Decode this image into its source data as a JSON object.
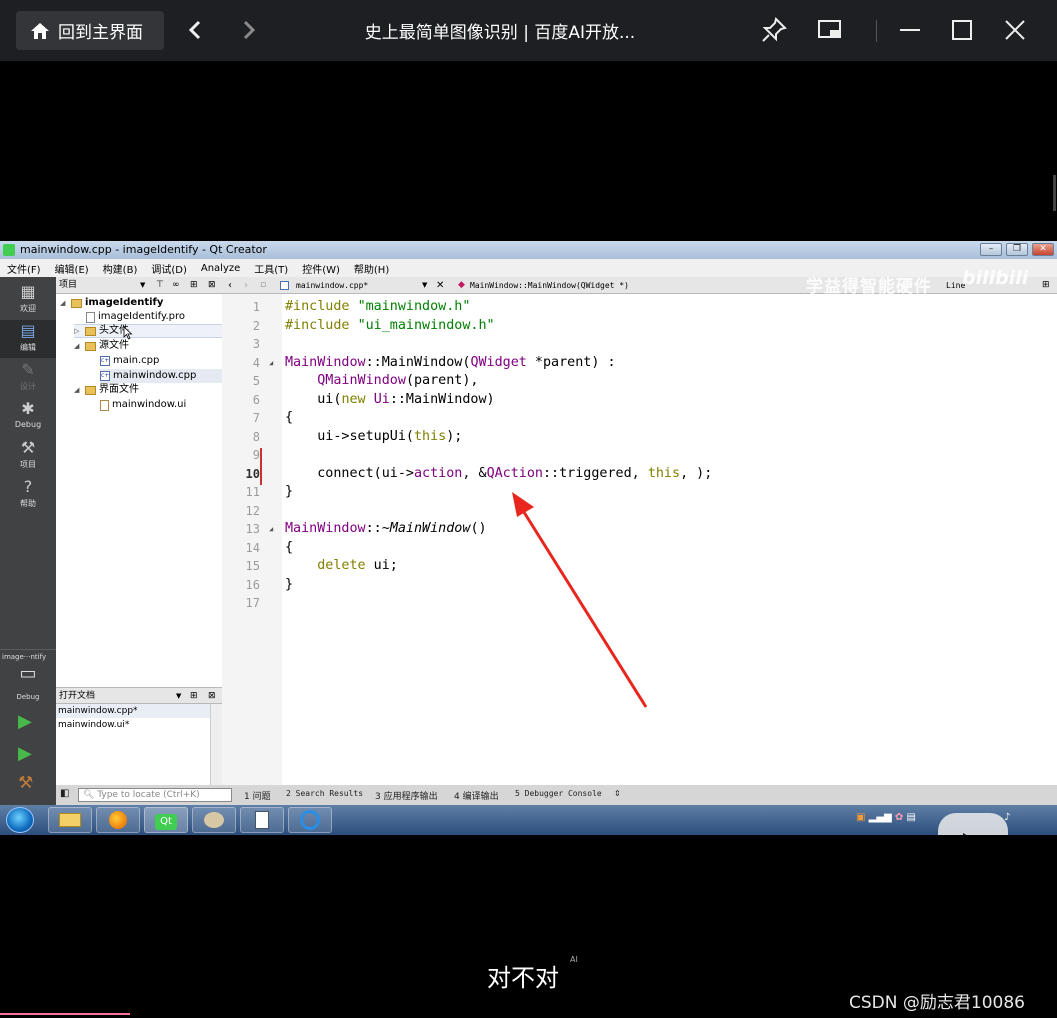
{
  "player": {
    "home_label": "回到主界面",
    "title": "史上最简单图像识别 | 百度AI开放...",
    "icons": [
      "home-icon",
      "back-icon",
      "forward-icon",
      "pin-icon",
      "pip-icon",
      "minimize-icon",
      "maximize-icon",
      "close-icon"
    ]
  },
  "qt": {
    "window_title": "mainwindow.cpp - imageIdentify - Qt Creator",
    "menu": [
      "文件(F)",
      "编辑(E)",
      "构建(B)",
      "调试(D)",
      "Analyze",
      "工具(T)",
      "控件(W)",
      "帮助(H)"
    ],
    "modes": [
      {
        "label": "欢迎",
        "icon": "grid-icon"
      },
      {
        "label": "编辑",
        "icon": "edit-icon"
      },
      {
        "label": "设计",
        "icon": "pen-icon"
      },
      {
        "label": "Debug",
        "icon": "bug-icon"
      },
      {
        "label": "项目",
        "icon": "wrench-icon"
      },
      {
        "label": "帮助",
        "icon": "help-icon"
      }
    ],
    "target": {
      "project": "image···ntify",
      "config": "Debug"
    },
    "project_panel_title": "项目",
    "tree": [
      {
        "label": "imageIdentify",
        "depth": 0,
        "type": "project"
      },
      {
        "label": "imageIdentify.pro",
        "depth": 1,
        "type": "file"
      },
      {
        "label": "头文件",
        "depth": 1,
        "type": "folder"
      },
      {
        "label": "源文件",
        "depth": 1,
        "type": "folder"
      },
      {
        "label": "main.cpp",
        "depth": 2,
        "type": "cpp"
      },
      {
        "label": "mainwindow.cpp",
        "depth": 2,
        "type": "cpp"
      },
      {
        "label": "界面文件",
        "depth": 1,
        "type": "folder"
      },
      {
        "label": "mainwindow.ui",
        "depth": 2,
        "type": "ui"
      }
    ],
    "open_docs_title": "打开文档",
    "open_docs": [
      "mainwindow.cpp*",
      "mainwindow.ui*"
    ],
    "editor": {
      "file_tab": "mainwindow.cpp*",
      "symbol": "MainWindow::MainWindow(QWidget *)",
      "line_info": "Line"
    },
    "code": [
      "#include \"mainwindow.h\"",
      "#include \"ui_mainwindow.h\"",
      "",
      "MainWindow::MainWindow(QWidget *parent) :",
      "    QMainWindow(parent),",
      "    ui(new Ui::MainWindow)",
      "{",
      "    ui->setupUi(this);",
      "",
      "    connect(ui->action, &QAction::triggered, this, );",
      "}",
      "",
      "MainWindow::~MainWindow()",
      "{",
      "    delete ui;",
      "}",
      ""
    ],
    "current_line": 10,
    "locate_placeholder": "Type to locate (Ctrl+K)",
    "bottom_tabs": [
      "1 问题",
      "2 Search Results",
      "3 应用程序输出",
      "4 编译输出",
      "5 Debugger Console"
    ]
  },
  "overlay": {
    "watermark": "学益得智能硬件",
    "bili_logo": "bilibili",
    "subtitle": "对不对",
    "ai_tag": "AI",
    "csdn": "CSDN @励志君10086"
  },
  "colors": {
    "annotation_arrow": "#e8261d",
    "progress": "#fb7299",
    "keyword": "#808000",
    "string": "#008000",
    "type": "#800080"
  }
}
